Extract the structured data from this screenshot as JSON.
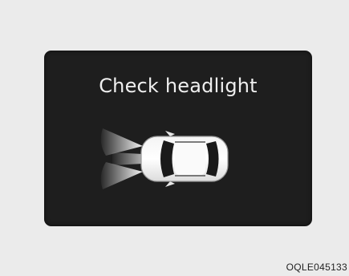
{
  "display": {
    "message": "Check headlight",
    "icon": "car-headlight-warning-icon"
  },
  "caption": {
    "code": "OQLE045133"
  },
  "colors": {
    "page_background": "#ebebeb",
    "display_background": "#1e1e1e",
    "text": "#efefef"
  }
}
